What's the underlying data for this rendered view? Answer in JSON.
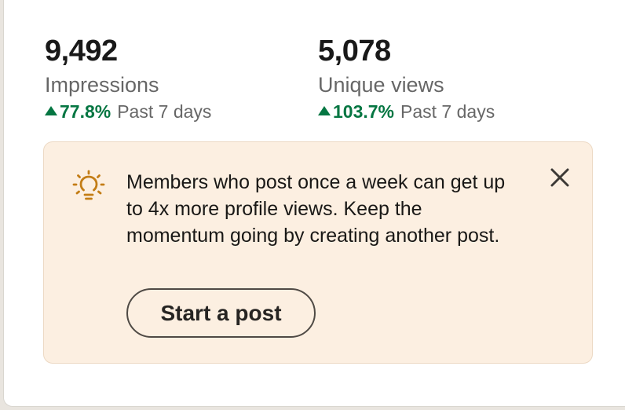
{
  "stats": [
    {
      "value": "9,492",
      "label": "Impressions",
      "trend_pct": "77.8%",
      "trend_period": "Past 7 days",
      "trend_direction": "up"
    },
    {
      "value": "5,078",
      "label": "Unique views",
      "trend_pct": "103.7%",
      "trend_period": "Past 7 days",
      "trend_direction": "up"
    }
  ],
  "tip": {
    "icon": "lightbulb-icon",
    "text": "Members who post once a week can get up to 4x more profile views. Keep the momentum going by creating another post.",
    "button_label": "Start a post",
    "close_icon": "close-icon"
  },
  "colors": {
    "positive_trend": "#057642",
    "tip_background": "#fcefe1",
    "lightbulb": "#c37d16"
  }
}
